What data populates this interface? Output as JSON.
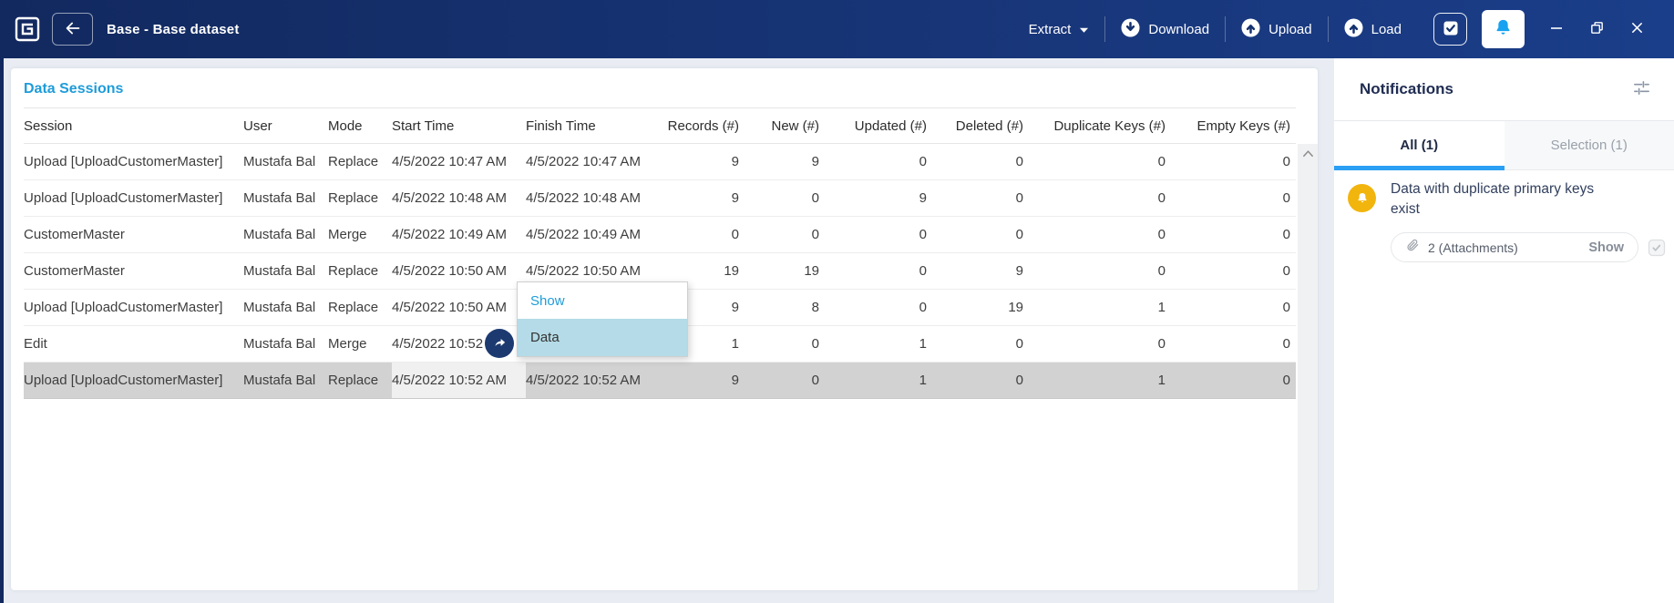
{
  "titlebar": {
    "title": "Base - Base dataset",
    "menus": {
      "extract": "Extract",
      "download": "Download",
      "upload": "Upload",
      "load": "Load"
    }
  },
  "data_sessions": {
    "title": "Data Sessions",
    "columns": [
      "Session",
      "User",
      "Mode",
      "Start Time",
      "Finish Time",
      "Records (#)",
      "New (#)",
      "Updated (#)",
      "Deleted (#)",
      "Duplicate Keys (#)",
      "Empty Keys (#)"
    ],
    "rows": [
      {
        "session": "Upload [UploadCustomerMaster]",
        "user": "Mustafa Bal",
        "mode": "Replace",
        "start_time": "4/5/2022 10:47 AM",
        "finish_time": "4/5/2022 10:47 AM",
        "records": "9",
        "new": "9",
        "updated": "0",
        "deleted": "0",
        "duplicate_keys": "0",
        "empty_keys": "0",
        "selected": false
      },
      {
        "session": "Upload [UploadCustomerMaster]",
        "user": "Mustafa Bal",
        "mode": "Replace",
        "start_time": "4/5/2022 10:48 AM",
        "finish_time": "4/5/2022 10:48 AM",
        "records": "9",
        "new": "0",
        "updated": "9",
        "deleted": "0",
        "duplicate_keys": "0",
        "empty_keys": "0",
        "selected": false
      },
      {
        "session": "CustomerMaster",
        "user": "Mustafa Bal",
        "mode": "Merge",
        "start_time": "4/5/2022 10:49 AM",
        "finish_time": "4/5/2022 10:49 AM",
        "records": "0",
        "new": "0",
        "updated": "0",
        "deleted": "0",
        "duplicate_keys": "0",
        "empty_keys": "0",
        "selected": false
      },
      {
        "session": "CustomerMaster",
        "user": "Mustafa Bal",
        "mode": "Replace",
        "start_time": "4/5/2022 10:50 AM",
        "finish_time": "4/5/2022 10:50 AM",
        "records": "19",
        "new": "19",
        "updated": "0",
        "deleted": "9",
        "duplicate_keys": "0",
        "empty_keys": "0",
        "selected": false
      },
      {
        "session": "Upload [UploadCustomerMaster]",
        "user": "Mustafa Bal",
        "mode": "Replace",
        "start_time": "4/5/2022 10:50 AM",
        "finish_time": "",
        "records": "9",
        "new": "8",
        "updated": "0",
        "deleted": "19",
        "duplicate_keys": "1",
        "empty_keys": "0",
        "selected": false
      },
      {
        "session": "Edit",
        "user": "Mustafa Bal",
        "mode": "Merge",
        "start_time": "4/5/2022 10:52",
        "finish_time": "",
        "records": "1",
        "new": "0",
        "updated": "1",
        "deleted": "0",
        "duplicate_keys": "0",
        "empty_keys": "0",
        "selected": false
      },
      {
        "session": "Upload [UploadCustomerMaster]",
        "user": "Mustafa Bal",
        "mode": "Replace",
        "start_time": "4/5/2022 10:52 AM",
        "finish_time": "4/5/2022 10:52 AM",
        "records": "9",
        "new": "0",
        "updated": "1",
        "deleted": "0",
        "duplicate_keys": "1",
        "empty_keys": "0",
        "selected": true
      }
    ]
  },
  "context_menu": {
    "header": "Show",
    "items": [
      {
        "label": "Data",
        "highlighted": true
      }
    ]
  },
  "notifications": {
    "title": "Notifications",
    "tabs": [
      {
        "label": "All (1)",
        "active": true
      },
      {
        "label": "Selection (1)",
        "active": false
      }
    ],
    "items": [
      {
        "message": "Data with duplicate primary keys exist",
        "attachments": "2 (Attachments)",
        "action": "Show"
      }
    ]
  },
  "icons": {
    "back": "←",
    "caret-down": "▾",
    "download": "⬇",
    "upload": "⬆",
    "load": "⬆",
    "tasks": "☑",
    "bell": "🔔",
    "minimize": "–",
    "restore": "❐",
    "close": "✕",
    "scroll-up": "⌃",
    "share": "➦",
    "filter": "⚎",
    "paperclip": "📎",
    "warning-bell": "🔔",
    "attachment-check": "☑"
  },
  "colors": {
    "titlebar-bg-1": "#12295f",
    "titlebar-bg-2": "#1b3e8a",
    "accent-blue": "#1e9cd9",
    "bell-blue": "#19a2f0",
    "selected-row": "#d2d2d2",
    "menu-highlight": "#b4dbe7",
    "warning-yellow": "#f2b50e",
    "tab-underline": "#2b9ff4",
    "app-bg": "#e9edf3"
  }
}
